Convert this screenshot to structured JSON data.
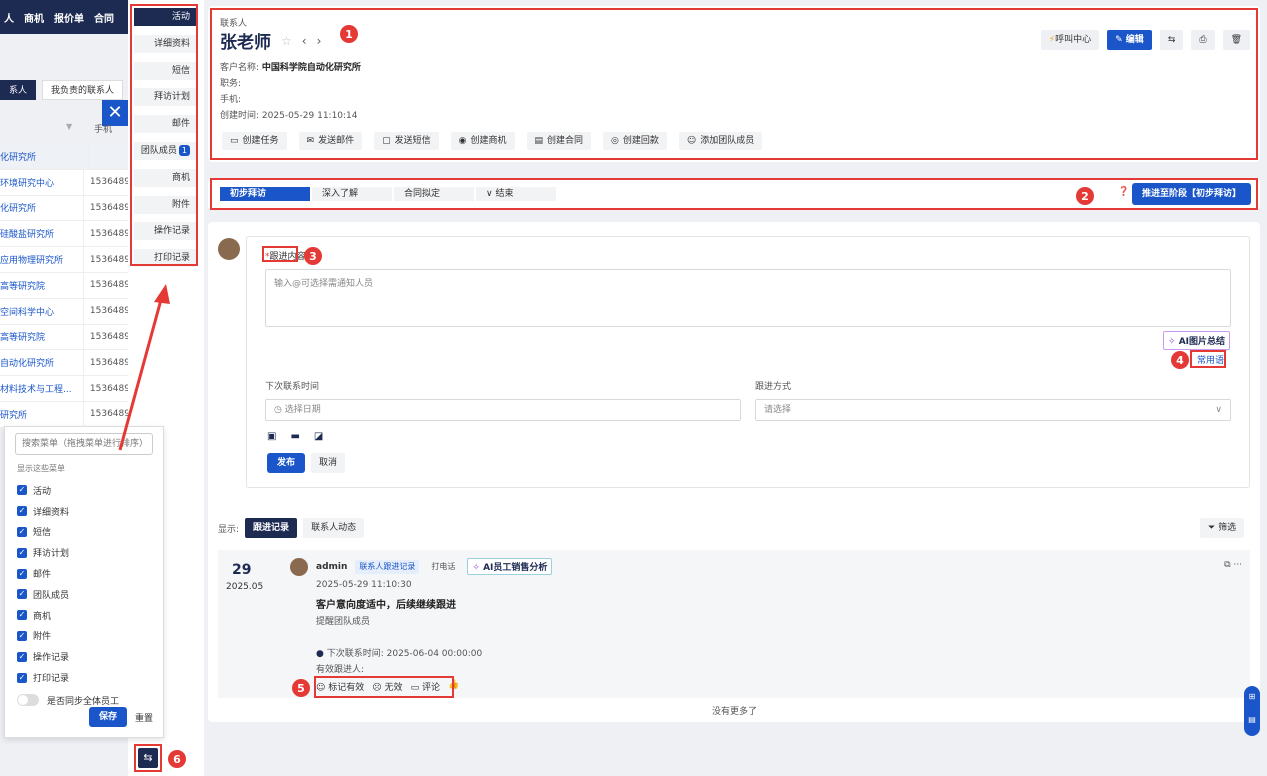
{
  "topnav": [
    "人",
    "商机",
    "报价单",
    "合同"
  ],
  "left_tabs": [
    "系人",
    "我负责的联系人"
  ],
  "left_list": {
    "col_header": "手机",
    "rows": [
      {
        "name": "化研究所",
        "phone": "",
        "grey": true
      },
      {
        "name": "环境研究中心",
        "phone": "1536489"
      },
      {
        "name": "化研究所",
        "phone": "1536489"
      },
      {
        "name": "硅酸盐研究所",
        "phone": "1536489"
      },
      {
        "name": "应用物理研究所",
        "phone": "1536489"
      },
      {
        "name": "高等研究院",
        "phone": "1536489"
      },
      {
        "name": "空间科学中心",
        "phone": "1536489"
      },
      {
        "name": "高等研究院",
        "phone": "1536489"
      },
      {
        "name": "自动化研究所",
        "phone": "1536489"
      },
      {
        "name": "材料技术与工程...",
        "phone": "1536489"
      },
      {
        "name": "研究所",
        "phone": "1536489"
      }
    ]
  },
  "side_menu": [
    {
      "label": "活动",
      "active": true
    },
    {
      "label": "详细资料"
    },
    {
      "label": "短信"
    },
    {
      "label": "拜访计划"
    },
    {
      "label": "邮件"
    },
    {
      "label": "团队成员",
      "count": "1"
    },
    {
      "label": "商机"
    },
    {
      "label": "附件"
    },
    {
      "label": "操作记录"
    },
    {
      "label": "打印记录"
    }
  ],
  "config_panel": {
    "search_placeholder": "搜索菜单（拖拽菜单进行排序）",
    "hint": "显示这些菜单",
    "items": [
      "活动",
      "详细资料",
      "短信",
      "拜访计划",
      "邮件",
      "团队成员",
      "商机",
      "附件",
      "操作记录",
      "打印记录"
    ],
    "sync_label": "是否同步全体员工",
    "save": "保存",
    "reset": "重置"
  },
  "contact": {
    "breadcrumb": "联系人",
    "name": "张老师",
    "customer_label": "客户名称:",
    "customer_value": "中国科学院自动化研究所",
    "position_label": "职务:",
    "mobile_label": "手机:",
    "created_label": "创建时间:",
    "created_value": "2025-05-29 11:10:14",
    "actions": [
      "创建任务",
      "发送邮件",
      "发送短信",
      "创建商机",
      "创建合同",
      "创建回款",
      "添加团队成员"
    ],
    "top_buttons": {
      "call": "呼叫中心",
      "edit": "编辑"
    }
  },
  "stages": {
    "items": [
      "初步拜访",
      "深入了解",
      "合同拟定",
      "结束"
    ],
    "advance": "推进至阶段【初步拜访】"
  },
  "followup": {
    "content_label": "跟进内容",
    "content_placeholder": "输入@可选择需通知人员",
    "ai_summary": "AI图片总结",
    "common_phrases": "常用语",
    "next_time_label": "下次联系时间",
    "next_time_placeholder": "选择日期",
    "method_label": "跟进方式",
    "method_placeholder": "请选择",
    "publish": "发布",
    "cancel": "取消"
  },
  "records": {
    "show_label": "显示:",
    "tabs": [
      "跟进记录",
      "联系人动态"
    ],
    "filter": "筛选",
    "day": "29",
    "month": "2025.05",
    "user": "admin",
    "tag_type": "联系人跟进记录",
    "tag_method": "打电话",
    "ai_analysis": "AI员工销售分析",
    "time": "2025-05-29 11:10:30",
    "content": "客户意向度适中，后续继续跟进",
    "remind": "提醒团队成员",
    "next_contact": "下次联系时间: 2025-06-04 00:00:00",
    "valid_person": "有效跟进人:",
    "mark_valid": "标记有效",
    "invalid": "无效",
    "comment": "评论",
    "no_more": "没有更多了"
  },
  "callouts": [
    "1",
    "2",
    "3",
    "4",
    "5",
    "6"
  ]
}
